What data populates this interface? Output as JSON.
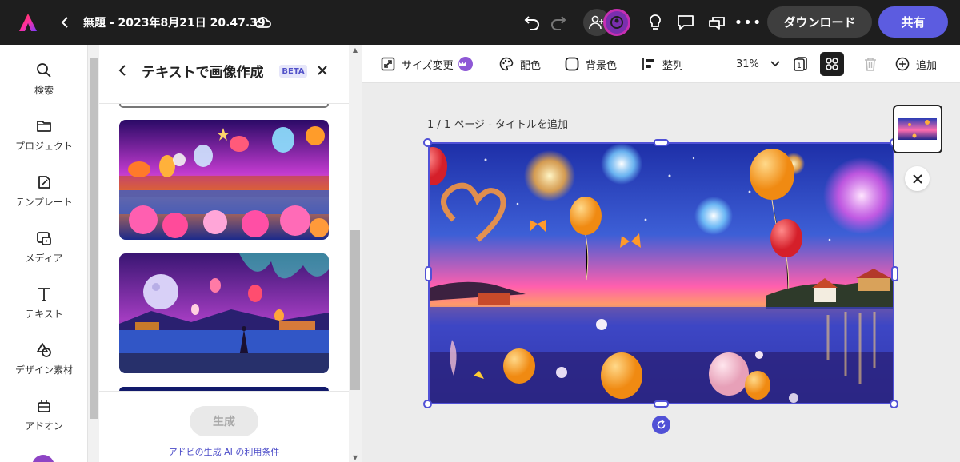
{
  "topbar": {
    "doc_title": "無題 - 2023年8月21日 20.47.39",
    "download_label": "ダウンロード",
    "share_label": "共有",
    "more_label": "•••"
  },
  "rail": {
    "items": [
      {
        "label": "検索",
        "icon": "search-icon"
      },
      {
        "label": "プロジェクト",
        "icon": "folder-icon"
      },
      {
        "label": "テンプレート",
        "icon": "template-icon"
      },
      {
        "label": "メディア",
        "icon": "media-icon"
      },
      {
        "label": "テキスト",
        "icon": "text-icon"
      },
      {
        "label": "デザイン素材",
        "icon": "shapes-icon"
      },
      {
        "label": "アドオン",
        "icon": "addon-icon"
      }
    ]
  },
  "panel": {
    "title": "テキストで画像作成",
    "badge": "BETA",
    "generate_label": "生成",
    "terms_link": "アドビの生成 AI の利用条件"
  },
  "toolbar": {
    "resize_label": "サイズ変更",
    "color_label": "配色",
    "background_label": "背景色",
    "arrange_label": "整列",
    "zoom_value": "31%",
    "add_label": "追加",
    "page_count": "1"
  },
  "canvas": {
    "page_label": "1 / 1 ページ - タイトルを追加"
  },
  "colors": {
    "topbar_bg": "#1e1e1e",
    "accent": "#5151d6",
    "share_bg": "#5c5ce0",
    "badge_text": "#5252c9"
  }
}
